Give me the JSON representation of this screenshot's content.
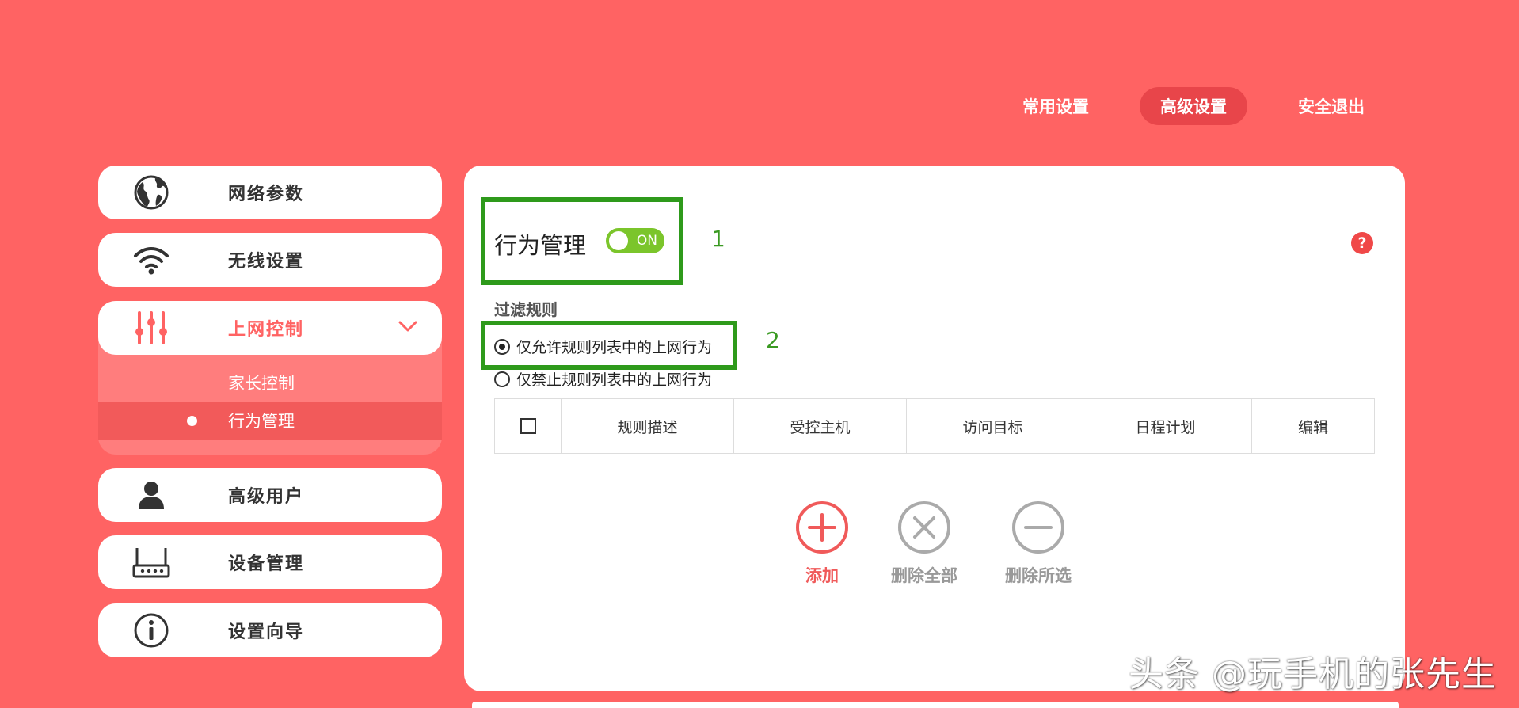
{
  "top_nav": {
    "items": [
      {
        "label": "常用设置",
        "active": false
      },
      {
        "label": "高级设置",
        "active": true
      },
      {
        "label": "安全退出",
        "active": false
      }
    ]
  },
  "sidebar": {
    "items": [
      {
        "label": "网络参数",
        "icon": "globe-icon"
      },
      {
        "label": "无线设置",
        "icon": "wifi-icon"
      },
      {
        "label": "上网控制",
        "icon": "sliders-icon",
        "active": true,
        "expanded": true
      },
      {
        "label": "高级用户",
        "icon": "user-icon"
      },
      {
        "label": "设备管理",
        "icon": "router-icon"
      },
      {
        "label": "设置向导",
        "icon": "info-icon"
      }
    ],
    "submenu": [
      {
        "label": "家长控制",
        "active": false
      },
      {
        "label": "行为管理",
        "active": true
      }
    ]
  },
  "main": {
    "title": "行为管理",
    "toggle": {
      "label": "ON",
      "state": true
    },
    "step1": "1",
    "step2": "2",
    "help": "?",
    "filter_title": "过滤规则",
    "radios": [
      {
        "label": "仅允许规则列表中的上网行为",
        "checked": true
      },
      {
        "label": "仅禁止规则列表中的上网行为",
        "checked": false
      }
    ],
    "table_headers": [
      "规则描述",
      "受控主机",
      "访问目标",
      "日程计划",
      "编辑"
    ],
    "actions": {
      "add": "添加",
      "delete_all": "删除全部",
      "delete_selected": "删除所选"
    }
  },
  "watermark": "头条 @玩手机的张先生",
  "colors": {
    "background": "#FF6363",
    "accent": "#F05A5A",
    "highlight_green": "#2E9A1B",
    "toggle_on": "#7BC52B"
  }
}
